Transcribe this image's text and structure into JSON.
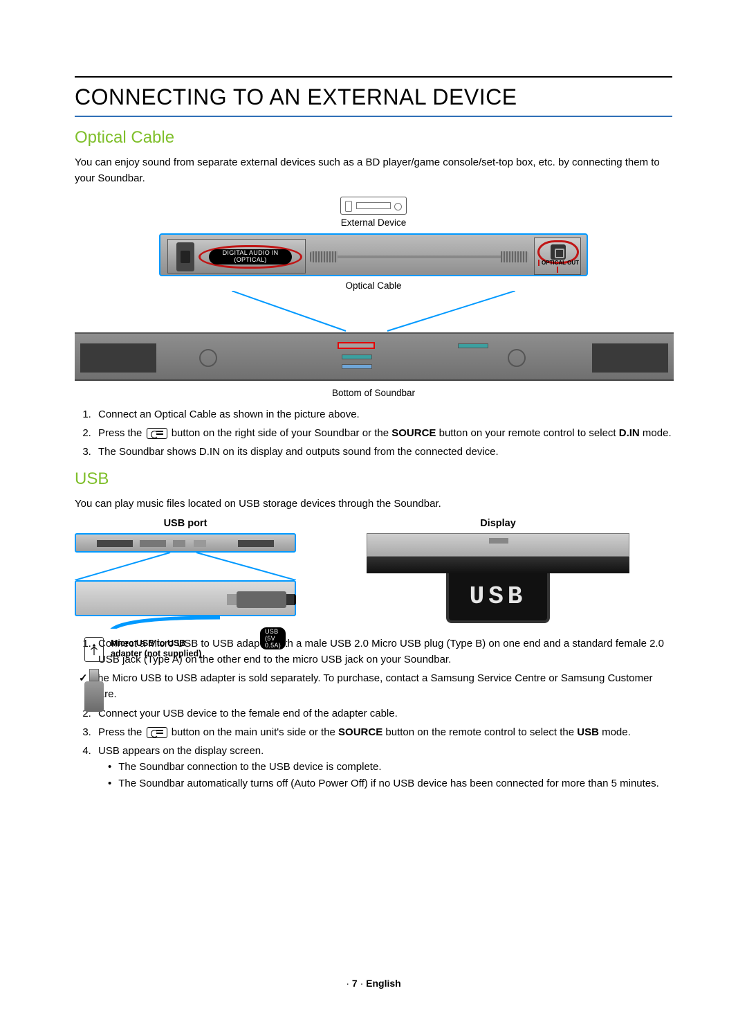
{
  "title": "CONNECTING TO AN EXTERNAL DEVICE",
  "optical": {
    "heading": "Optical Cable",
    "intro": "You can enjoy sound from separate external devices such as a BD player/game console/set-top box, etc. by connecting them to your Soundbar.",
    "labels": {
      "external_device": "External Device",
      "digital_audio_in_line1": "DIGITAL AUDIO IN",
      "digital_audio_in_line2": "(OPTICAL)",
      "optical_cable": "Optical Cable",
      "optical_out": "OPTICAL OUT",
      "bottom_of_soundbar": "Bottom of Soundbar"
    },
    "steps": {
      "s1": "Connect an Optical Cable as shown in the picture above.",
      "s2_a": "Press the ",
      "s2_b": " button on the right side of your Soundbar or the ",
      "s2_source": "SOURCE",
      "s2_c": " button on your remote control to select ",
      "s2_din": "D.IN",
      "s2_d": " mode.",
      "s3": "The Soundbar shows D.IN on its display and outputs sound from the connected device."
    }
  },
  "usb": {
    "heading": "USB",
    "intro": "You can play music files located on USB storage devices through the Soundbar.",
    "labels": {
      "usb_port": "USB port",
      "display": "Display",
      "usb_badge": "USB (5V 0.5A)",
      "adapter_note": "Micro USB to USB adapter (not supplied)",
      "display_text": "USB"
    },
    "steps": {
      "s1": "Connect a Micro USB to USB adapter with a male USB 2.0 Micro USB plug (Type B) on one end and a standard female 2.0 USB jack (Type A) on the other end to the micro USB jack on your Soundbar.",
      "s1_check": "The Micro USB to USB adapter is sold separately. To purchase, contact a Samsung Service Centre or Samsung Customer Care.",
      "s2": "Connect your USB device to the female end of the adapter cable.",
      "s3_a": "Press the ",
      "s3_b": " button on the main unit's side or the ",
      "s3_source": "SOURCE",
      "s3_c": " button on the remote control to select the ",
      "s3_usb": "USB",
      "s3_d": " mode.",
      "s4": "USB appears on the display screen.",
      "s4_b1": "The Soundbar connection to the USB device is complete.",
      "s4_b2": "The Soundbar automatically turns off (Auto Power Off) if no USB device has been connected for more than 5 minutes."
    }
  },
  "footer": {
    "dot": "·",
    "page": "7",
    "lang": "English"
  }
}
